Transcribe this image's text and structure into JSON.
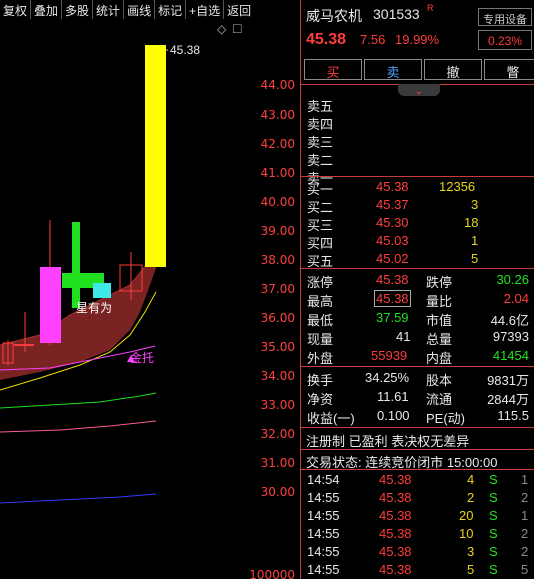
{
  "toolbar": [
    "复权",
    "叠加",
    "多股",
    "统计",
    "画线",
    "标记",
    "+自选",
    "返回"
  ],
  "chart_controls": {
    "diamond": "◇",
    "box": "□"
  },
  "y_axis": [
    "44.00",
    "43.00",
    "42.00",
    "41.00",
    "40.00",
    "39.00",
    "38.00",
    "37.00",
    "36.00",
    "35.00",
    "34.00",
    "33.00",
    "32.00",
    "31.00",
    "30.00"
  ],
  "high_marker": "45.38",
  "annotations": {
    "star": "星有为",
    "support": "金托"
  },
  "volume_axis": "100000",
  "stock": {
    "name": "威马农机",
    "code": "301533",
    "badge": "R",
    "device": "专用设备",
    "price": "45.38",
    "change": "7.56",
    "pct": "19.99%",
    "turnover_tag": "0.23%"
  },
  "actions": [
    "买",
    "卖",
    "撤",
    "瞥"
  ],
  "collapse_icon": "⌄",
  "sell_levels": [
    "卖五",
    "卖四",
    "卖三",
    "卖二",
    "卖一"
  ],
  "buy_levels": [
    {
      "label": "买一",
      "price": "45.38",
      "vol": "12356"
    },
    {
      "label": "买二",
      "price": "45.37",
      "vol": "3"
    },
    {
      "label": "买三",
      "price": "45.30",
      "vol": "18"
    },
    {
      "label": "买四",
      "price": "45.03",
      "vol": "1"
    },
    {
      "label": "买五",
      "price": "45.02",
      "vol": "5"
    }
  ],
  "stats": [
    {
      "l1": "涨停",
      "v1": "45.38",
      "l2": "跌停",
      "v2": "30.26"
    },
    {
      "l1": "最高",
      "v1": "45.38",
      "l2": "量比",
      "v2": "2.04"
    },
    {
      "l1": "最低",
      "v1": "37.59",
      "l2": "市值",
      "v2": "44.6亿"
    },
    {
      "l1": "现量",
      "v1": "41",
      "l2": "总量",
      "v2": "97393"
    },
    {
      "l1": "外盘",
      "v1": "55939",
      "l2": "内盘",
      "v2": "41454"
    }
  ],
  "fund": [
    {
      "l1": "换手",
      "v1": "34.25%",
      "l2": "股本",
      "v2": "9831万"
    },
    {
      "l1": "净资",
      "v1": "11.61",
      "l2": "流通",
      "v2": "2844万"
    },
    {
      "l1": "收益(一)",
      "v1": "0.100",
      "l2": "PE(动)",
      "v2": "115.5"
    }
  ],
  "tags": "注册制 已盈利 表决权无差异",
  "trade_status": "交易状态: 连续竞价闭市 15:00:00",
  "ticks": [
    {
      "t": "14:54",
      "p": "45.38",
      "v": "4",
      "d": "S",
      "n": "1"
    },
    {
      "t": "14:55",
      "p": "45.38",
      "v": "2",
      "d": "S",
      "n": "2"
    },
    {
      "t": "14:55",
      "p": "45.38",
      "v": "20",
      "d": "S",
      "n": "1"
    },
    {
      "t": "14:55",
      "p": "45.38",
      "v": "10",
      "d": "S",
      "n": "2"
    },
    {
      "t": "14:55",
      "p": "45.38",
      "v": "3",
      "d": "S",
      "n": "2"
    },
    {
      "t": "14:55",
      "p": "45.38",
      "v": "5",
      "d": "S",
      "n": "5"
    }
  ]
}
